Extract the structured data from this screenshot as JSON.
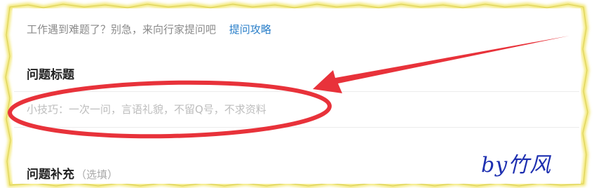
{
  "intro": {
    "text": "工作遇到难题了？别急，来向行家提问吧",
    "guide_link": "提问攻略"
  },
  "question_title": {
    "label": "问题标题",
    "placeholder": "小技巧：一次一问，言语礼貌，不留Q号，不求资料"
  },
  "question_supplement": {
    "label": "问题补充",
    "optional": "（选填）"
  },
  "annotation": {
    "highlight_color": "#e8323a",
    "signature": "by竹风",
    "signature_color": "#1d2fb0"
  },
  "colors": {
    "link": "#2a7fc9",
    "border_glow": "#f2e66a"
  }
}
